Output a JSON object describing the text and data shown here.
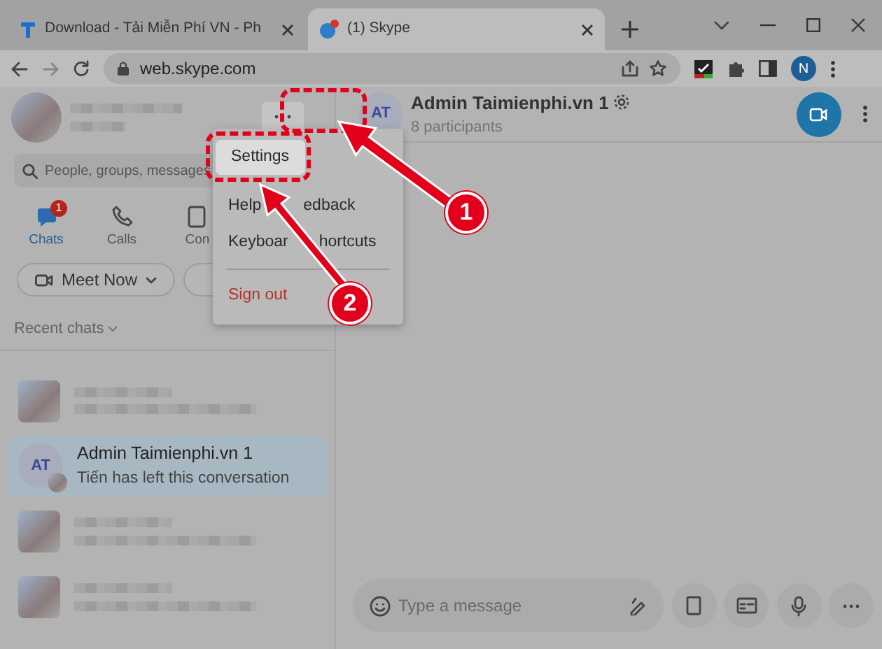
{
  "browser": {
    "tabs": [
      {
        "title": "Download - Tải Miễn Phí VN - Ph",
        "kind": "site",
        "selected": false
      },
      {
        "title": "(1) Skype",
        "kind": "skype",
        "selected": true
      }
    ],
    "url": "web.skype.com",
    "profile_initial": "N"
  },
  "sidebar": {
    "search": {
      "placeholder": "People, groups, messages"
    },
    "nav": [
      {
        "label": "Chats",
        "badge": "1",
        "selected": true
      },
      {
        "label": "Calls",
        "selected": false
      },
      {
        "label": "Con",
        "selected": false
      }
    ],
    "meet_now": "Meet Now",
    "recent_label": "Recent chats",
    "chats": [
      {
        "kind": "blurred",
        "selected": false
      },
      {
        "kind": "chat",
        "initials": "AT",
        "name": "Admin Taimienphi.vn 1",
        "preview": "Tiến has left this conversation",
        "selected": true
      },
      {
        "kind": "blurred",
        "selected": false
      },
      {
        "kind": "blurred",
        "selected": false
      }
    ]
  },
  "menu": {
    "items": [
      {
        "label": "Settings",
        "kind": "item",
        "selected": true
      },
      {
        "label": "Help",
        "label_end": "edback",
        "kind": "item",
        "selected": false
      },
      {
        "label": "Keyboar",
        "label_end": "hortcuts",
        "kind": "item",
        "selected": false
      },
      {
        "label": "Sign out",
        "kind": "danger",
        "selected": false
      }
    ]
  },
  "conversation": {
    "initials": "AT",
    "title": "Admin Taimienphi.vn 1",
    "subtitle": "8 participants",
    "composer": {
      "placeholder": "Type a message"
    }
  },
  "annotations": [
    {
      "number": "1"
    },
    {
      "number": "2"
    }
  ]
}
